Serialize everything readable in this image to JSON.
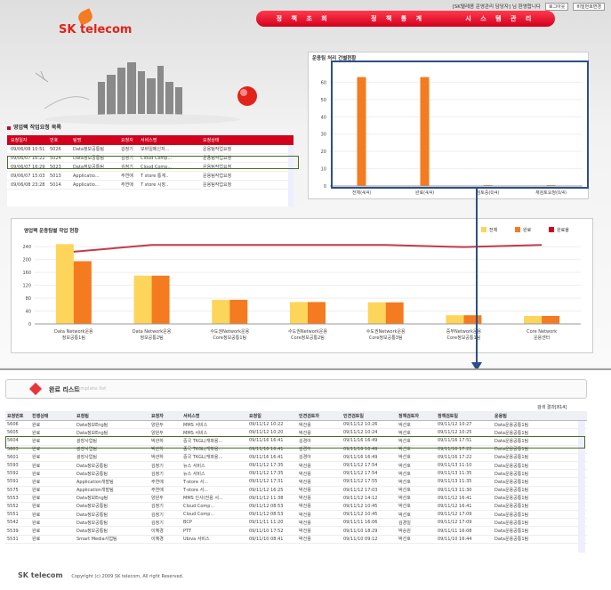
{
  "header": {
    "util_text": "[SK텔레콤 운영관리 담당자] 님 환영합니다",
    "util_btn1": "로그아웃",
    "util_btn2": "비밀번호변경",
    "logo": "SK telecom",
    "nav": [
      "정 책 조 회",
      "정 책 통 계",
      "시 스 템 관 리"
    ]
  },
  "work_list": {
    "title": "영업팩 작업요청 목록",
    "columns": [
      "요청일자",
      "번호",
      "팀명",
      "요청자",
      "서비스명",
      "요청상태"
    ],
    "rows": [
      [
        "09/06/08 10:51",
        "5026",
        "Data정보공통팀",
        "김정기",
        "모바일메신저...",
        "운용팀작업요청"
      ],
      [
        "09/06/07 16:22",
        "5024",
        "Data정보공통팀",
        "김정기",
        "Cloud Comp...",
        "운용팀작업요청"
      ],
      [
        "09/06/07 16:29",
        "5023",
        "Data정보공통팀",
        "김정기",
        "Cloud Comp...",
        "운용팀작업요청"
      ],
      [
        "09/06/07 15:03",
        "5013",
        "Applicatio...",
        "주연애",
        "T store 통계..",
        "운용팀작업요청"
      ],
      [
        "09/06/08 23:28",
        "5014",
        "Applicatio...",
        "주연애",
        "T store 시장..",
        "운용팀작업요청"
      ]
    ]
  },
  "done_list": {
    "title": "완료 리스트",
    "subtitle": "Complete list",
    "result_count": "검색 결과[814]",
    "columns": [
      "요청번호",
      "진행상태",
      "요청팀",
      "요청자",
      "서비스명",
      "요청일",
      "인견검토자",
      "인견검토일",
      "정책검토자",
      "정책검토일",
      "운용팀"
    ],
    "rows": [
      [
        "5606",
        "완료",
        "Data정보Eng팀",
        "양원두",
        "MMS 서비스",
        "09/11/12 10:22",
        "박건용",
        "09/11/12 10:26",
        "박선호",
        "09/11/12 10:27",
        "Data운용공통1팀"
      ],
      [
        "5605",
        "완료",
        "Data정보Eng팀",
        "양원두",
        "MMS 서비스",
        "09/11/12 10:20",
        "박건용",
        "09/11/12 10:24",
        "박선호",
        "09/11/12 10:25",
        "Data운용공통1팀"
      ],
      [
        "5604",
        "완료",
        "광장사업팀",
        "박관하",
        "중국 TKGL(캐파용...",
        "09/11/16 16:41",
        "김경아",
        "09/11/16 16:49",
        "박선호",
        "09/11/16 17:51",
        "Data운용공통1팀"
      ],
      [
        "5603",
        "완료",
        "광장사업팀",
        "박관하",
        "중국 TKGL(캐파용...",
        "09/11/16 16:41",
        "김경아",
        "09/11/16 16:49",
        "박선호",
        "09/11/16 17:22",
        "Data운용공통1팀"
      ],
      [
        "5601",
        "완료",
        "광장사업팀",
        "박관하",
        "중국 TKGL(캐파용...",
        "09/11/16 16:41",
        "김경아",
        "09/11/16 16:49",
        "박선호",
        "09/11/16 17:22",
        "Data운용공통1팀"
      ],
      [
        "5593",
        "완료",
        "Data정보공통팀",
        "김정기",
        "뉴스 서비스",
        "09/11/12 17:35",
        "박건용",
        "09/11/12 17:54",
        "박선호",
        "09/11/13 11:10",
        "Data운용공통1팀"
      ],
      [
        "5592",
        "완료",
        "Data정보공통팀",
        "김정기",
        "뉴스 서비스",
        "09/11/12 17:35",
        "박건용",
        "09/11/12 17:54",
        "박선호",
        "09/11/13 11:35",
        "Data운용공통1팀"
      ],
      [
        "5591",
        "완료",
        "Application개발팀",
        "주연애",
        "T-store 서...",
        "09/11/12 17:31",
        "박건용",
        "09/11/12 17:55",
        "박선호",
        "09/11/13 11:35",
        "Data운용공통1팀"
      ],
      [
        "5575",
        "완료",
        "Application개발팀",
        "주연애",
        "T-store 서...",
        "09/11/12 16:25",
        "박건용",
        "09/11/12 17:03",
        "박선호",
        "09/11/13 11:30",
        "Data운용공통1팀"
      ],
      [
        "5553",
        "완료",
        "Data정보Eng팀",
        "양원두",
        "MMS 인사(전용 서...",
        "09/11/12 11:38",
        "박건용",
        "09/11/12 14:12",
        "박선호",
        "09/11/12 16:41",
        "Data운용공통1팀"
      ],
      [
        "5552",
        "완료",
        "Data정보공통팀",
        "김정기",
        "Cloud Comp...",
        "09/11/12 08:53",
        "박건용",
        "09/11/12 10:45",
        "박선호",
        "09/11/12 16:41",
        "Data운용공통1팀"
      ],
      [
        "5551",
        "완료",
        "Data정보공통팀",
        "김정기",
        "Cloud Comp...",
        "09/11/12 08:53",
        "박건용",
        "09/11/12 10:45",
        "박선호",
        "09/11/12 17:09",
        "Data운용공통1팀"
      ],
      [
        "5542",
        "완료",
        "Data정보공통팀",
        "김정기",
        "BCP",
        "09/11/11 11:20",
        "박건용",
        "09/11/11 16:06",
        "김경일",
        "09/11/12 17:09",
        "Data운용공통1팀"
      ],
      [
        "5539",
        "완료",
        "Data정보공통팀",
        "이혜경",
        "PTT",
        "09/11/10 17:52",
        "박건용",
        "09/11/10 18:29",
        "박승원",
        "09/11/11 16:08",
        "Data운용공통1팀"
      ],
      [
        "5531",
        "완료",
        "Smart Media사업팀",
        "이혜경",
        "Ubiva 서비스",
        "09/11/10 08:41",
        "박건용",
        "09/11/10 09:12",
        "박선호",
        "09/11/10 16:44",
        "Data운용공통1팀"
      ]
    ]
  },
  "footer": {
    "logo": "SK telecom",
    "copyright": "Copyright (c) 2009 SK telecom, All right Reserved."
  },
  "colors": {
    "brand_red": "#d1001c",
    "bar_orange": "#f47b20",
    "bar_yellow": "#fdd55a",
    "line_red": "#c33a4a",
    "highlight_green": "#4b6b27",
    "selection_blue": "#2c4f8a"
  },
  "chart_data": [
    {
      "type": "bar",
      "title": "운용팀 처리 건별현황",
      "categories": [
        "전체(4/4)",
        "완료(4/4)",
        "검토중(0/4)",
        "재검토요청(0/4)"
      ],
      "values": [
        63,
        63,
        0.5,
        0.5
      ],
      "ylim": [
        0,
        70
      ],
      "yticks": [
        0,
        10,
        20,
        30,
        40,
        50,
        60
      ]
    },
    {
      "type": "bar",
      "title": "영업팩 운용팀별 작업 현황",
      "categories": [
        "Data Network운용\n정보공통1팀",
        "Data Network운용\n정보공통2팀",
        "수도권Network운용\nCore정보공통1팀",
        "수도권Network운용\nCore정보공통2팀",
        "수도권Network운용\nCore정보공통3팀",
        "중부Network운용\nCore정보공통1팀",
        "Core Network\n운용센터"
      ],
      "series": [
        {
          "name": "전체",
          "values": [
            248,
            150,
            75,
            68,
            67,
            27,
            25
          ]
        },
        {
          "name": "완료",
          "values": [
            195,
            150,
            75,
            68,
            67,
            27,
            25
          ]
        },
        {
          "name": "완료율",
          "values": [
            78,
            100,
            100,
            100,
            100,
            93,
            100
          ]
        }
      ],
      "ylim": [
        0,
        260
      ],
      "yticks": [
        0,
        40,
        80,
        120,
        160,
        200,
        240
      ],
      "legend": "top-right"
    }
  ]
}
